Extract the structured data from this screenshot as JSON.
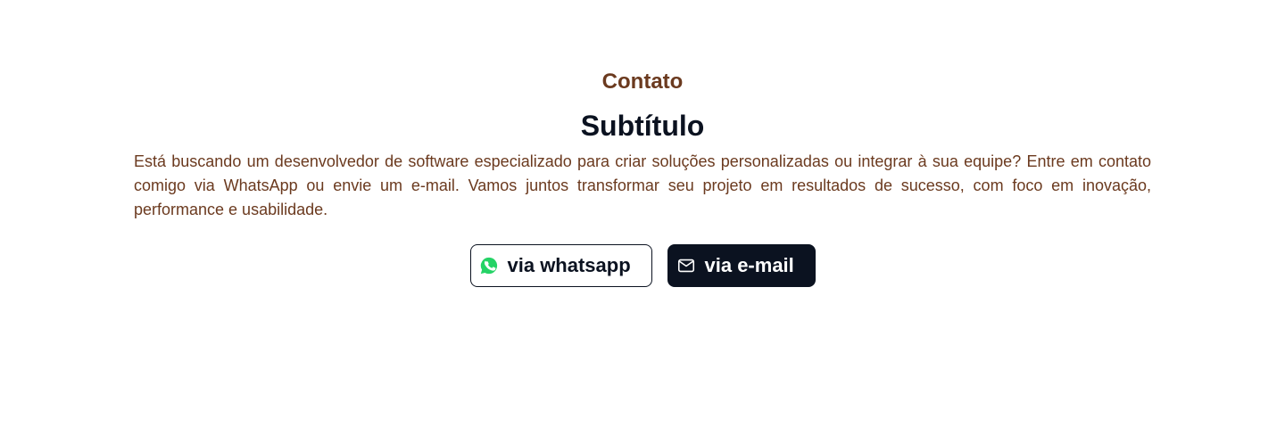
{
  "contact": {
    "eyebrow": "Contato",
    "title": "Subtítulo",
    "description": "Está buscando um desenvolvedor de software especializado para criar soluções personalizadas ou integrar à sua equipe? Entre em contato comigo via WhatsApp ou envie um e-mail. Vamos juntos transformar seu projeto em resultados de sucesso, com foco em inovação, performance e usabilidade.",
    "buttons": {
      "whatsapp": {
        "label": "via whatsapp",
        "icon": "whatsapp-icon"
      },
      "email": {
        "label": "via e-mail",
        "icon": "mail-icon"
      }
    }
  },
  "colors": {
    "accent_brown": "#6b3a1f",
    "dark": "#0b1220",
    "whatsapp_green": "#25d366",
    "background": "#ffffff"
  }
}
